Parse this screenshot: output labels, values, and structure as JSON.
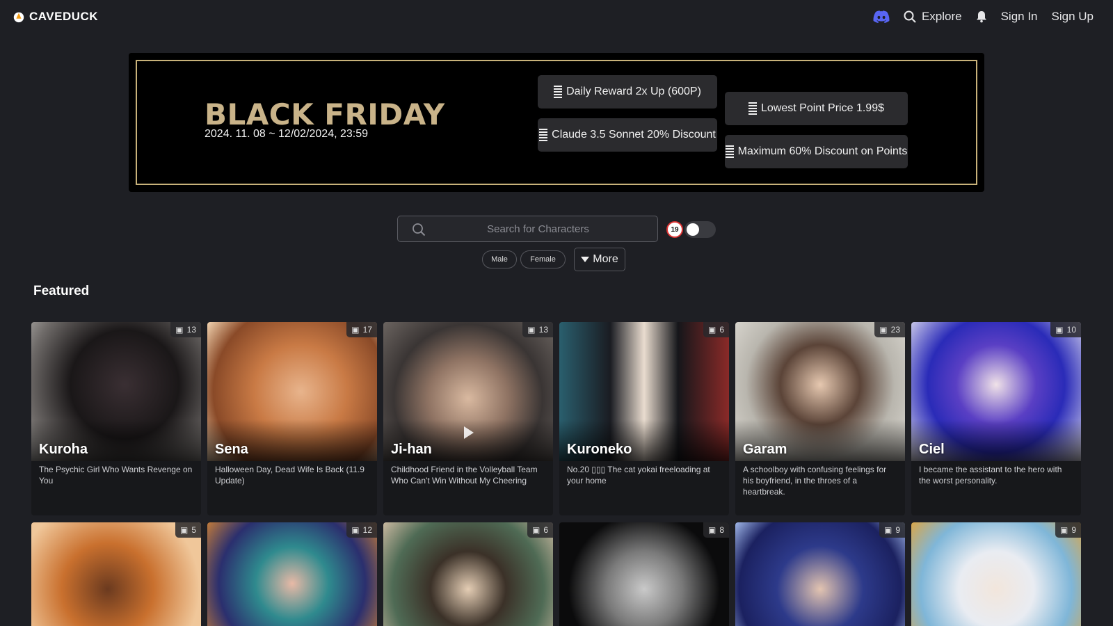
{
  "header": {
    "brand": "CAVEDUCK",
    "nav": {
      "explore": "Explore",
      "sign_in": "Sign In",
      "sign_up": "Sign Up"
    }
  },
  "banner": {
    "title": "BLACK FRIDAY",
    "dates": "2024. 11. 08 ~ 12/02/2024, 23:59",
    "promos": [
      "Daily Reward 2x Up (600P)",
      "Claude 3.5 Sonnet 20% Discount",
      "Lowest Point Price 1.99$",
      "Maximum 60% Discount on Points"
    ]
  },
  "search": {
    "placeholder": "Search for Characters",
    "age_badge": "19"
  },
  "filters": {
    "male": "Male",
    "female": "Female",
    "more": "More"
  },
  "featured": {
    "title": "Featured",
    "cards": [
      {
        "name": "Kuroha",
        "count": "13",
        "desc": "The Psychic Girl Who Wants Revenge on You"
      },
      {
        "name": "Sena",
        "count": "17",
        "desc": "Halloween Day, Dead Wife Is Back (11.9 Update)"
      },
      {
        "name": "Ji-han",
        "count": "13",
        "desc": "Childhood Friend in the Volleyball Team Who Can't Win Without My Cheering"
      },
      {
        "name": "Kuroneko",
        "count": "6",
        "desc": "No.20 ▯▯▯ The cat yokai freeloading at your home"
      },
      {
        "name": "Garam",
        "count": "23",
        "desc": "A schoolboy with confusing feelings for his boyfriend, in the throes of a heartbreak."
      },
      {
        "name": "Ciel",
        "count": "10",
        "desc": "I became the assistant to the hero with the worst personality."
      }
    ],
    "row2_counts": [
      "5",
      "12",
      "6",
      "8",
      "9",
      "9"
    ]
  }
}
